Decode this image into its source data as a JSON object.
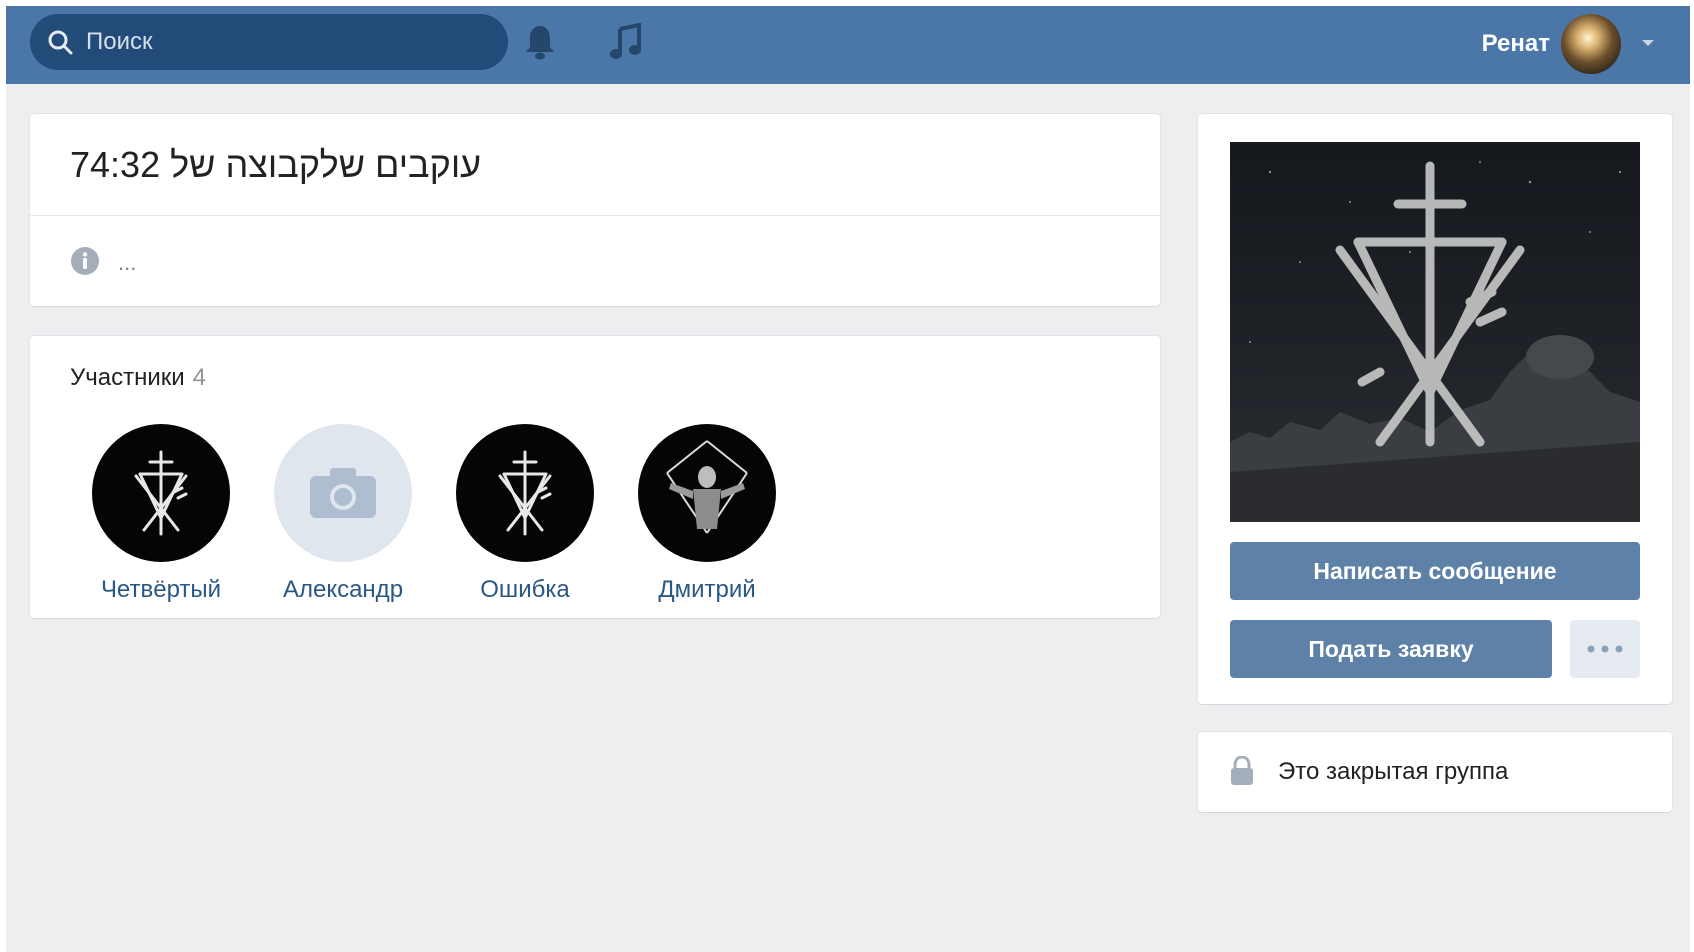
{
  "header": {
    "search_placeholder": "Поиск",
    "user_name": "Ренат",
    "icons": [
      "search-icon",
      "bell-icon",
      "music-icon",
      "chevron-down-icon"
    ]
  },
  "group": {
    "title": "עוקבים שלקבוצה של 74:32",
    "status": "..."
  },
  "members": {
    "label": "Участники",
    "count": "4",
    "items": [
      {
        "name": "Четвёртый"
      },
      {
        "name": "Александр"
      },
      {
        "name": "Ошибка"
      },
      {
        "name": "Дмитрий"
      }
    ]
  },
  "actions": {
    "message_button": "Написать сообщение",
    "request_button": "Подать заявку",
    "more_button": "•••"
  },
  "closed_notice": "Это закрытая группа",
  "colors": {
    "header_bg": "#4a76a8",
    "button_bg": "#5e81a8",
    "link": "#2a5885",
    "page_bg": "#edeef0"
  }
}
